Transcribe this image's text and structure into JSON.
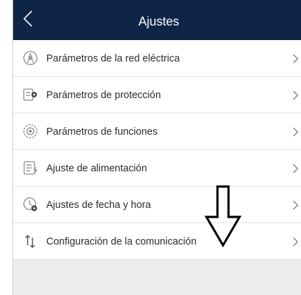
{
  "header": {
    "title": "Ajustes"
  },
  "settings_list": {
    "items": [
      {
        "label": "Parámetros de la red eléctrica",
        "icon": "grid-tower-icon"
      },
      {
        "label": "Parámetros de protección",
        "icon": "protection-list-icon"
      },
      {
        "label": "Parámetros de funciones",
        "icon": "function-gear-icon"
      },
      {
        "label": "Ajuste de alimentación",
        "icon": "power-document-icon"
      },
      {
        "label": "Ajustes de fecha y hora",
        "icon": "clock-settings-icon"
      },
      {
        "label": "Configuración de la comunicación",
        "icon": "up-down-arrows-icon"
      }
    ]
  },
  "colors": {
    "header_bg": "#0f2547",
    "page_bg": "#ececef",
    "row_bg": "#ffffff",
    "text": "#2b2b2b",
    "icon": "#8a8a8a"
  },
  "annotation": {
    "icon": "down-arrow-outline-icon"
  }
}
